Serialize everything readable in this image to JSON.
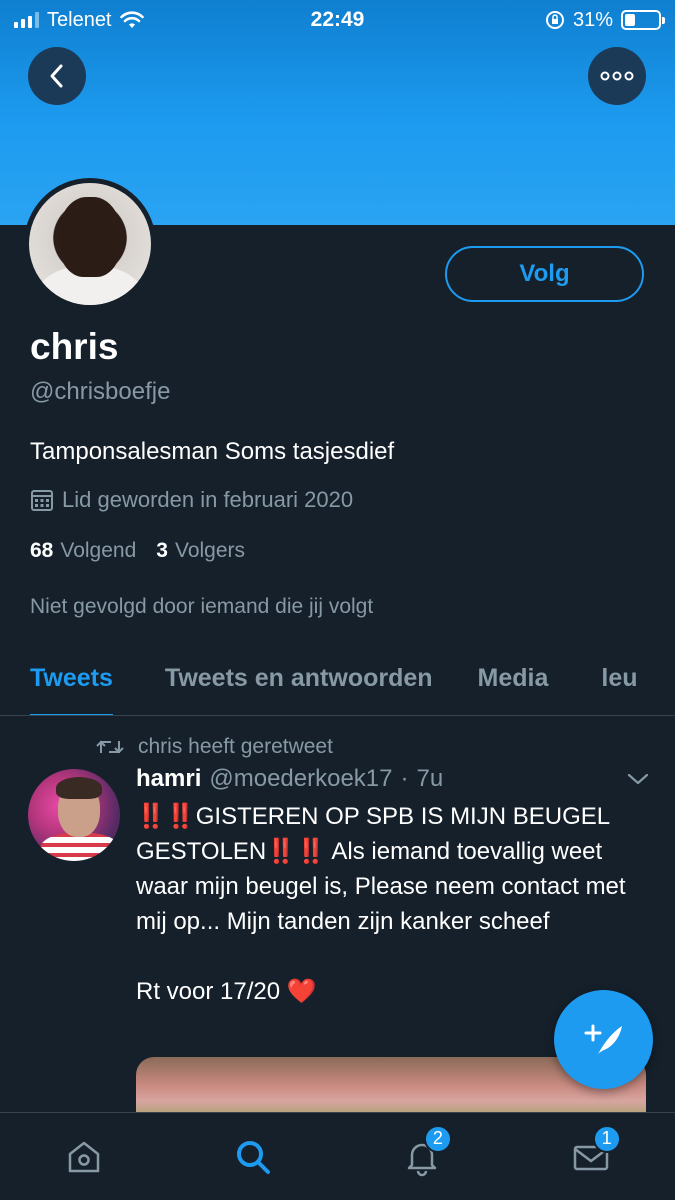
{
  "status_bar": {
    "carrier": "Telenet",
    "time": "22:49",
    "battery": "31%",
    "battery_level": 0.31
  },
  "profile": {
    "name": "chris",
    "handle": "@chrisboefje",
    "bio": "Tamponsalesman Soms tasjesdief",
    "joined": "Lid geworden in februari 2020",
    "following_count": "68",
    "following_label": "Volgend",
    "followers_count": "3",
    "followers_label": "Volgers",
    "not_followed": "Niet gevolgd door iemand die jij volgt",
    "follow_label": "Volg"
  },
  "tabs": [
    {
      "label": "Tweets",
      "active": true
    },
    {
      "label": "Tweets en antwoorden",
      "active": false
    },
    {
      "label": "Media",
      "active": false
    },
    {
      "label": "leu",
      "active": false
    }
  ],
  "tweet": {
    "retweet_label": "chris heeft geretweet",
    "author_name": "hamri",
    "author_handle": "@moederkoek17",
    "separator": "·",
    "time": "7u",
    "text_line1": "‼️‼️GISTEREN OP SPB IS MIJN BEUGEL GESTOLEN‼️‼️ Als iemand toevallig weet waar mijn beugel is, Please neem contact met mij op... Mijn tanden zijn kanker scheef",
    "text_line2": "Rt voor 17/20 ❤️"
  },
  "bottom_nav": {
    "notifications_badge": "2",
    "messages_badge": "1"
  },
  "colors": {
    "background": "#15202b",
    "accent": "#1d9bf0",
    "muted": "#8899a6"
  },
  "icons": [
    "back-icon",
    "more-icon",
    "calendar-icon",
    "retweet-icon",
    "chevron-down-icon",
    "compose-icon",
    "home-icon",
    "search-icon",
    "bell-icon",
    "mail-icon"
  ]
}
